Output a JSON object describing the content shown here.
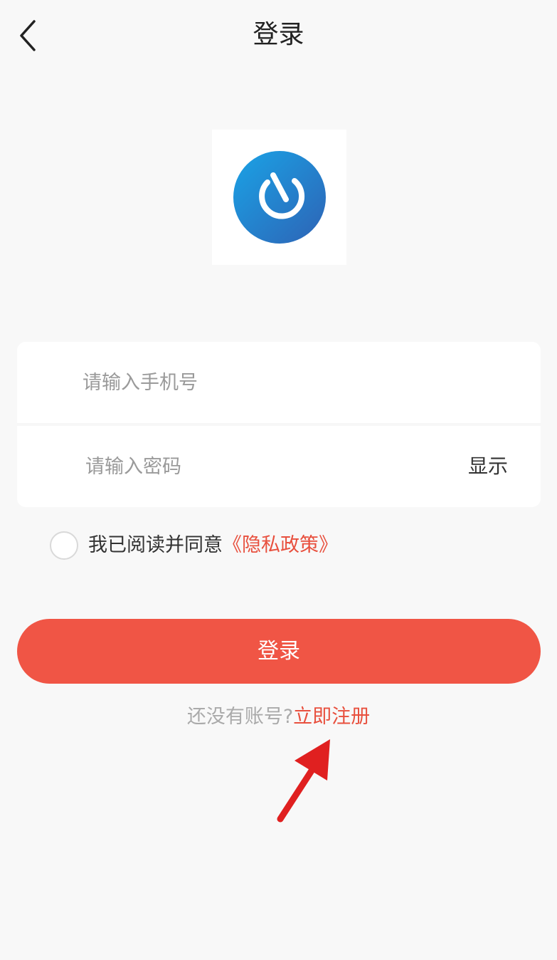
{
  "header": {
    "title": "登录",
    "back_icon": "chevron-left-icon"
  },
  "logo": {
    "icon": "app-logo",
    "colors": {
      "start": "#1aa3e6",
      "end": "#2e63b5"
    }
  },
  "form": {
    "phone_placeholder": "请输入手机号",
    "password_placeholder": "请输入密码",
    "show_label": "显示"
  },
  "agreement": {
    "text": "我已阅读并同意",
    "policy_link": "《隐私政策》",
    "checked": false
  },
  "login_button": {
    "label": "登录",
    "color": "#f05545"
  },
  "register": {
    "prompt": "还没有账号?",
    "link": "立即注册"
  },
  "annotation": {
    "icon": "red-arrow-icon",
    "color": "#e02020"
  }
}
